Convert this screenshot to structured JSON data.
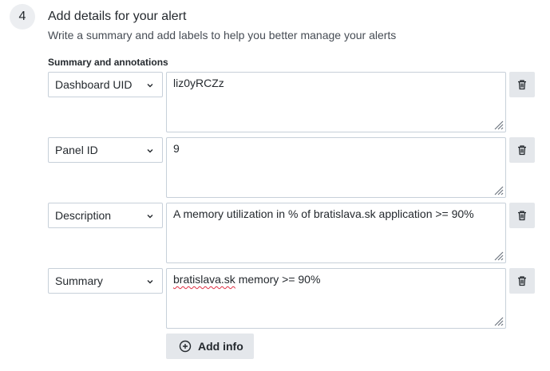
{
  "step": {
    "number": "4",
    "title": "Add details for your alert",
    "subtitle": "Write a summary and add labels to help you better manage your alerts"
  },
  "annotations": {
    "section_label": "Summary and annotations",
    "rows": [
      {
        "key": "Dashboard UID",
        "value": "liz0yRCZz"
      },
      {
        "key": "Panel ID",
        "value": "9"
      },
      {
        "key": "Description",
        "value": "A memory utilization in % of bratislava.sk application >= 90%"
      },
      {
        "key": "Summary",
        "value_misspelled": "bratislava.sk",
        "value_rest": " memory >= 90%"
      }
    ],
    "add_label": "Add info"
  },
  "icons": {
    "select_chevron": "chevron-down-icon",
    "delete": "trash-icon",
    "add": "plus-circle-icon",
    "resize": "resize-grip-icon"
  },
  "colors": {
    "border": "#c7d0d9",
    "button_bg": "#e4e7eb",
    "badge_bg": "#eceef1",
    "spellcheck": "#e02f44"
  }
}
